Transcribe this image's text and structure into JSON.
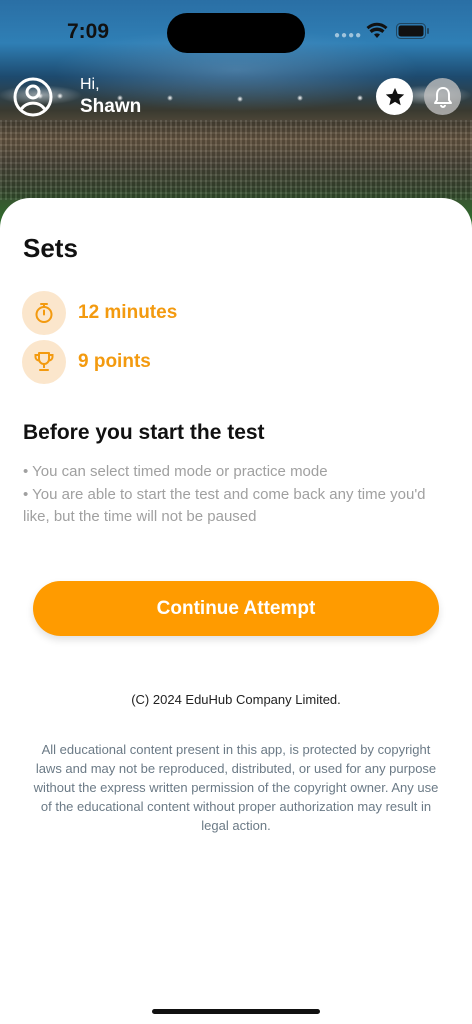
{
  "status_bar": {
    "time": "7:09"
  },
  "header": {
    "greeting": "Hi,",
    "username": "Shawn",
    "icons": {
      "avatar": "user-circle-icon",
      "favorite": "star-icon",
      "notifications": "bell-icon"
    }
  },
  "sheet": {
    "title": "Sets",
    "info": [
      {
        "icon": "stopwatch-icon",
        "text": "12 minutes"
      },
      {
        "icon": "trophy-icon",
        "text": "9 points"
      }
    ],
    "before_title": "Before you start the test",
    "bullets": [
      "• You can select timed mode or practice mode",
      "• You are able to start the test and come back any time you'd like, but the time will not be paused"
    ],
    "continue_label": "Continue Attempt",
    "copyright": "(C) 2024 EduHub Company Limited.",
    "legal": "All educational content present in this app, is protected by copyright laws and may not be reproduced, distributed, or used for any purpose without the express written permission of the copyright owner. Any use of the educational content without proper authorization may result in legal action."
  },
  "colors": {
    "accent": "#ff9b00",
    "accent_text": "#f39a0f",
    "accent_soft": "#fbe6cc"
  }
}
